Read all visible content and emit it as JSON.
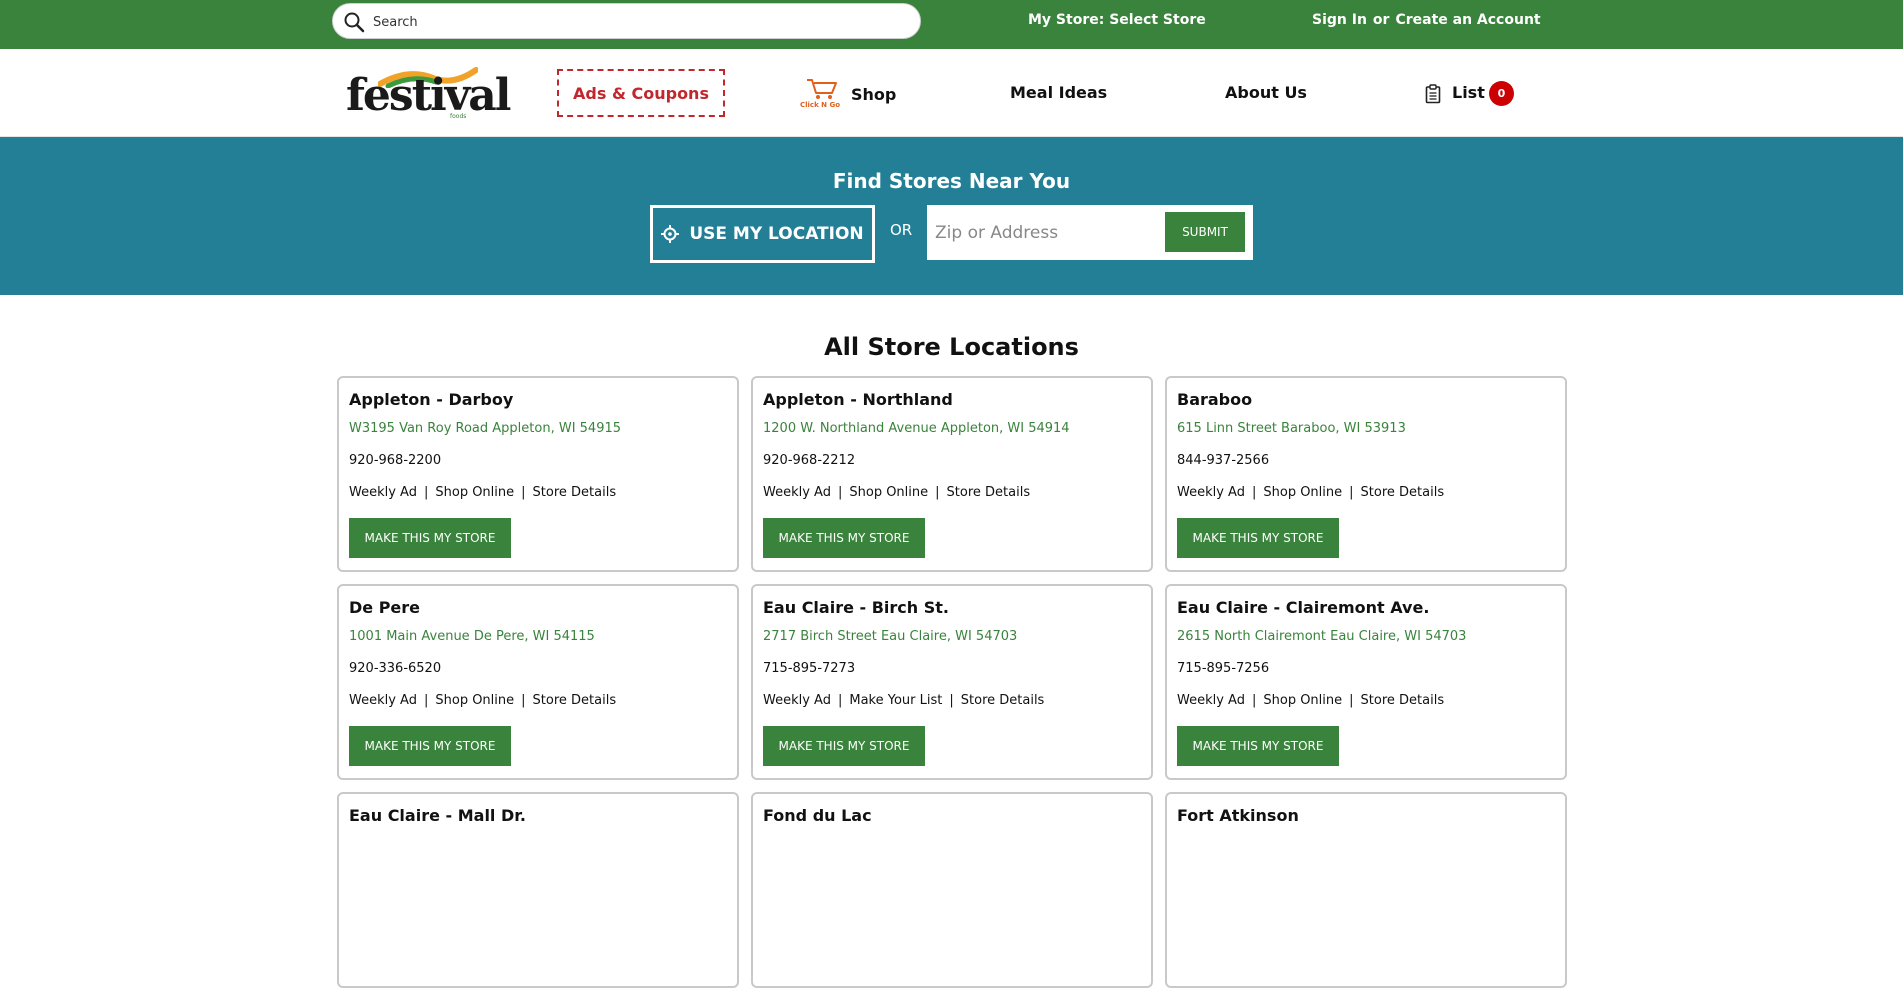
{
  "topbar": {
    "search_placeholder": "Search",
    "my_store": "My Store: Select Store",
    "sign_in": "Sign In",
    "or": "or",
    "create_account": "Create an Account"
  },
  "nav": {
    "logo_text": "festival",
    "logo_sub": "foods",
    "ads": "Ads & Coupons",
    "clickngo": "Click N Go",
    "shop": "Shop",
    "meal_ideas": "Meal Ideas",
    "about_us": "About Us",
    "list": "List",
    "list_count": "0"
  },
  "finder": {
    "title": "Find Stores Near You",
    "use_location": "USE MY LOCATION",
    "or": "OR",
    "zip_placeholder": "Zip or Address",
    "submit": "SUBMIT"
  },
  "locations": {
    "title": "All Store Locations",
    "button_label": "MAKE THIS MY STORE",
    "stores": [
      {
        "name": "Appleton - Darboy",
        "address": "W3195 Van Roy Road Appleton, WI 54915",
        "phone": "920-968-2200",
        "links": [
          "Weekly Ad",
          "Shop Online",
          "Store Details"
        ]
      },
      {
        "name": "Appleton - Northland",
        "address": "1200 W. Northland Avenue Appleton, WI 54914",
        "phone": "920-968-2212",
        "links": [
          "Weekly Ad",
          "Shop Online",
          "Store Details"
        ]
      },
      {
        "name": "Baraboo",
        "address": "615 Linn Street Baraboo, WI 53913",
        "phone": "844-937-2566",
        "links": [
          "Weekly Ad",
          "Shop Online",
          "Store Details"
        ]
      },
      {
        "name": "De Pere",
        "address": "1001 Main Avenue De Pere, WI 54115",
        "phone": "920-336-6520",
        "links": [
          "Weekly Ad",
          "Shop Online",
          "Store Details"
        ]
      },
      {
        "name": "Eau Claire - Birch St.",
        "address": "2717 Birch Street Eau Claire, WI 54703",
        "phone": "715-895-7273",
        "links": [
          "Weekly Ad",
          "Make Your List",
          "Store Details"
        ]
      },
      {
        "name": "Eau Claire - Clairemont Ave.",
        "address": "2615 North Clairemont Eau Claire, WI 54703",
        "phone": "715-895-7256",
        "links": [
          "Weekly Ad",
          "Shop Online",
          "Store Details"
        ]
      },
      {
        "name": "Eau Claire - Mall Dr.",
        "address": "",
        "phone": "",
        "links": []
      },
      {
        "name": "Fond du Lac",
        "address": "",
        "phone": "",
        "links": []
      },
      {
        "name": "Fort Atkinson",
        "address": "",
        "phone": "",
        "links": []
      }
    ]
  },
  "colors": {
    "brand_green": "#3a833c",
    "finder_teal": "#237f96",
    "coupon_red": "#c1272d",
    "badge_red": "#cc0000"
  }
}
